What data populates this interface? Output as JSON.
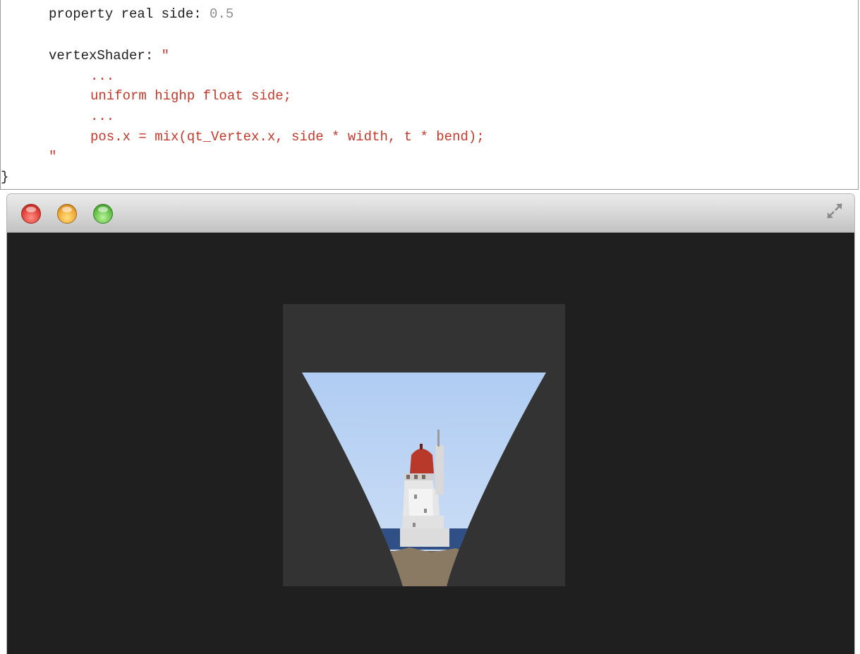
{
  "code": {
    "line1": {
      "keyword": "property real side: ",
      "value": "0.5"
    },
    "line2": {
      "keyword": "vertexShader: ",
      "quote_open": "\""
    },
    "line3": "...",
    "line4": "uniform highp float side;",
    "line5": "...",
    "line6": "pos.x = mix(qt_Vertex.x, side * width, t * bend);",
    "line7": "\"",
    "line8": "}"
  },
  "window": {
    "buttons": [
      "close-button",
      "minimize-button",
      "zoom-button"
    ],
    "fullscreen_icon": "fullscreen-icon",
    "content_background": "#1f1f1f",
    "panel_background": "#333333"
  },
  "colors": {
    "string": "#c0392b",
    "number": "#8e8e8e",
    "sky": "#a9c8ef",
    "lighthouse_roof": "#b8392a"
  }
}
